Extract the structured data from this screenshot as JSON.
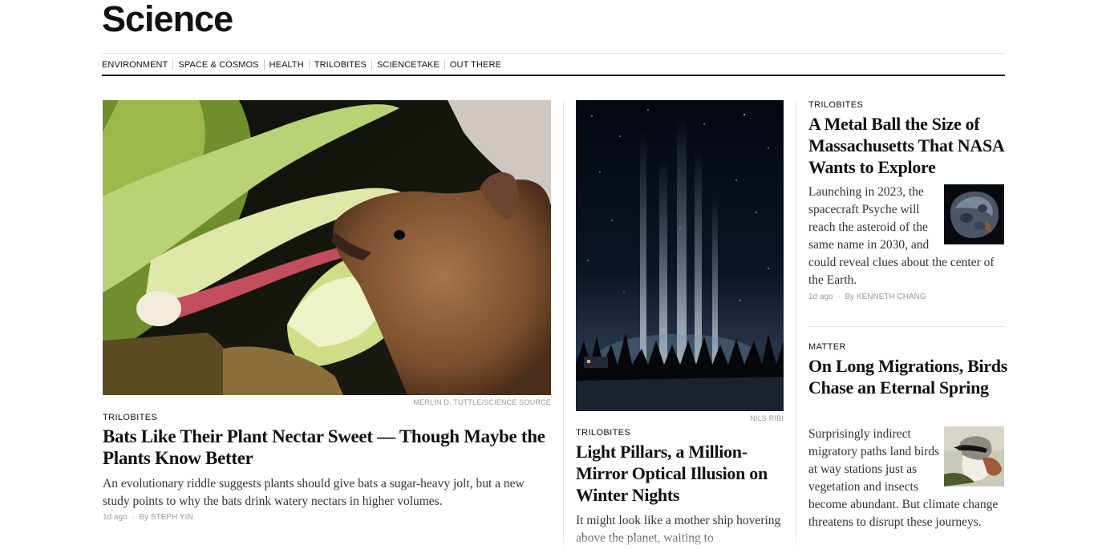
{
  "header": {
    "section_title": "Science"
  },
  "subnav": {
    "items": [
      "ENVIRONMENT",
      "SPACE & COSMOS",
      "HEALTH",
      "TRILOBITES",
      "SCIENCETAKE",
      "OUT THERE"
    ]
  },
  "lead_story": {
    "photo_credit": "MERLIN D. TUTTLE/SCIENCE SOURCE",
    "kicker": "TRILOBITES",
    "headline": "Bats Like Their Plant Nectar Sweet — Though Maybe the Plants Know Better",
    "summary": "An evolutionary riddle suggests plants should give bats a sugar-heavy jolt, but a new study points to why the bats drink watery nectars in higher volumes.",
    "timestamp": "1d ago",
    "byline": "By STEPH YIN"
  },
  "middle_story": {
    "photo_credit": "NILS RIBI",
    "kicker": "TRILOBITES",
    "headline": "Light Pillars, a Million-Mirror Optical Illusion on Winter Nights",
    "summary": "It might look like a mother ship hovering above the planet, waiting to"
  },
  "right_stories": [
    {
      "kicker": "TRILOBITES",
      "headline": "A Metal Ball the Size of Massachusetts That NASA Wants to Explore",
      "summary": "Launching in 2023, the spacecraft Psyche will reach the asteroid of the same name in 2030, and could reveal clues about the center of the Earth.",
      "timestamp": "1d ago",
      "byline": "By KENNETH CHANG"
    },
    {
      "kicker": "MATTER",
      "headline": "On Long Migrations, Birds Chase an Eternal Spring",
      "summary": "Surprisingly indirect migratory paths land birds at way stations just as vegetation and insects become abundant. But climate change threatens to disrupt these journeys."
    }
  ],
  "separator": "·"
}
